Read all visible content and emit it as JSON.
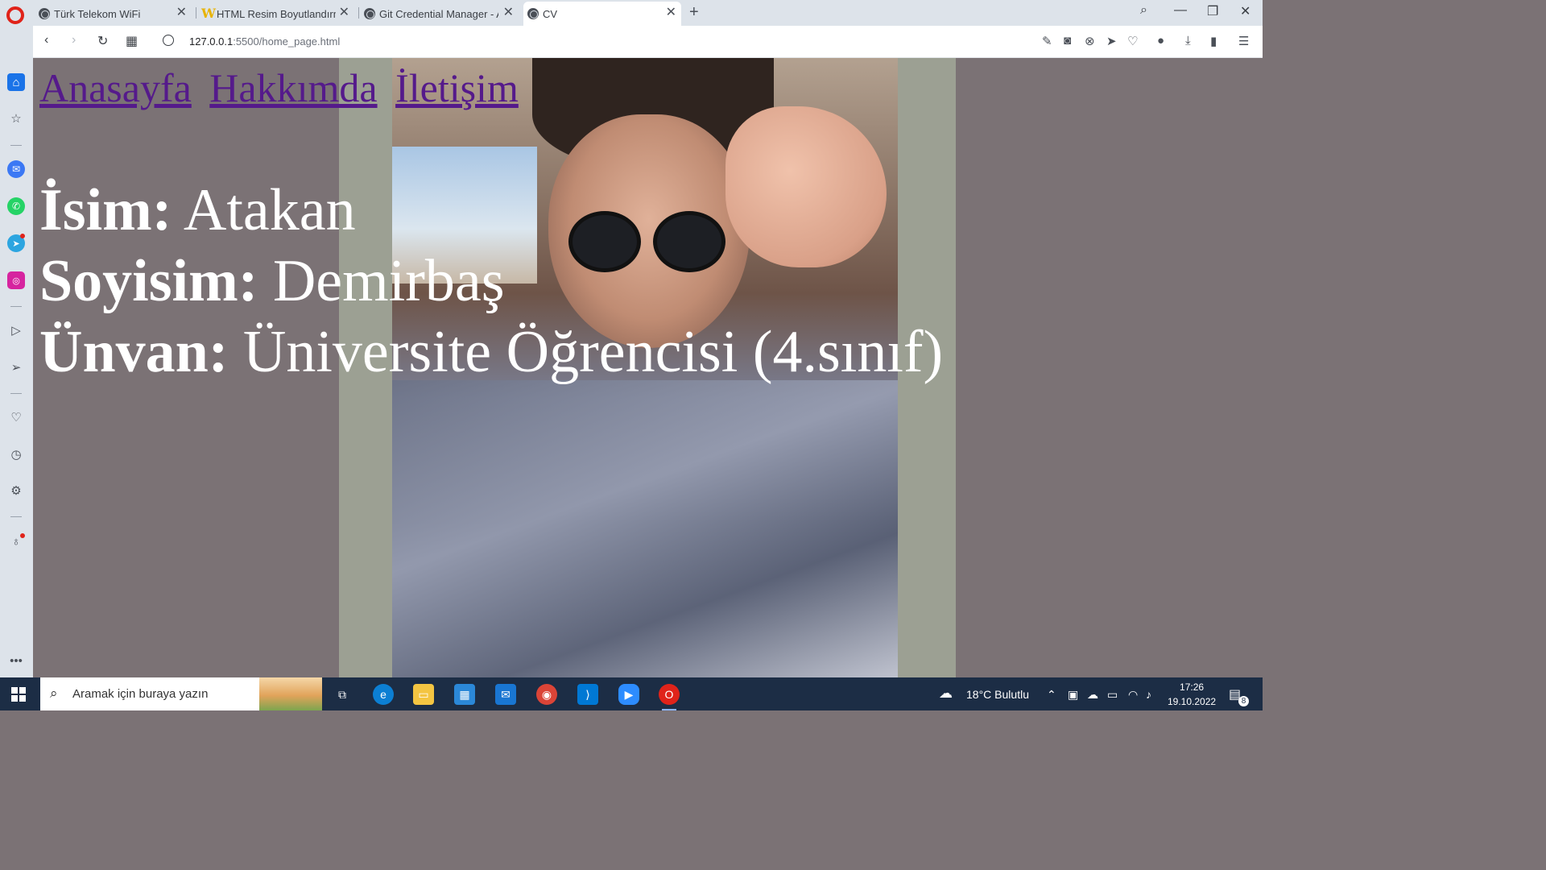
{
  "browser": {
    "tabs": [
      {
        "title": "Türk Telekom WiFi",
        "icon": "globe-icon",
        "active": false
      },
      {
        "title": "HTML Resim Boyutlandırma",
        "icon": "w-icon",
        "active": false
      },
      {
        "title": "Git Credential Manager - A",
        "icon": "globe-icon",
        "active": false
      },
      {
        "title": "CV",
        "icon": "globe-icon",
        "active": true
      }
    ],
    "new_tab_symbol": "+",
    "url_host": "127.0.0.1",
    "url_rest": ":5500/home_page.html",
    "window_controls": [
      "search-icon",
      "minimize-icon",
      "restore-icon",
      "close-icon"
    ]
  },
  "page": {
    "nav_links": [
      "Anasayfa",
      "Hakkımda",
      "İletişim"
    ],
    "fields": [
      {
        "label": "İsim:",
        "value": "Atakan"
      },
      {
        "label": "Soyisim:",
        "value": "Demirbaş"
      },
      {
        "label": "Ünvan:",
        "value": "Üniversite Öğrencisi (4.sınıf)"
      }
    ],
    "background_color": "#7b7275",
    "link_color": "#551a8b"
  },
  "sidebar": {
    "items": [
      "home-icon",
      "star-icon",
      "messenger-icon",
      "whatsapp-icon",
      "telegram-icon",
      "instagram-icon",
      "player-icon",
      "send-icon",
      "heart-icon",
      "history-icon",
      "settings-icon",
      "lightbulb-icon",
      "more-icon"
    ]
  },
  "taskbar": {
    "search_placeholder": "Aramak için buraya yazın",
    "weather": "18°C  Bulutlu",
    "time": "17:26",
    "date": "19.10.2022",
    "notification_count": "8",
    "apps": [
      "task-view-icon",
      "edge-icon",
      "file-explorer-icon",
      "store-icon",
      "mail-icon",
      "chrome-icon",
      "vscode-icon",
      "zoom-icon",
      "opera-icon"
    ]
  }
}
